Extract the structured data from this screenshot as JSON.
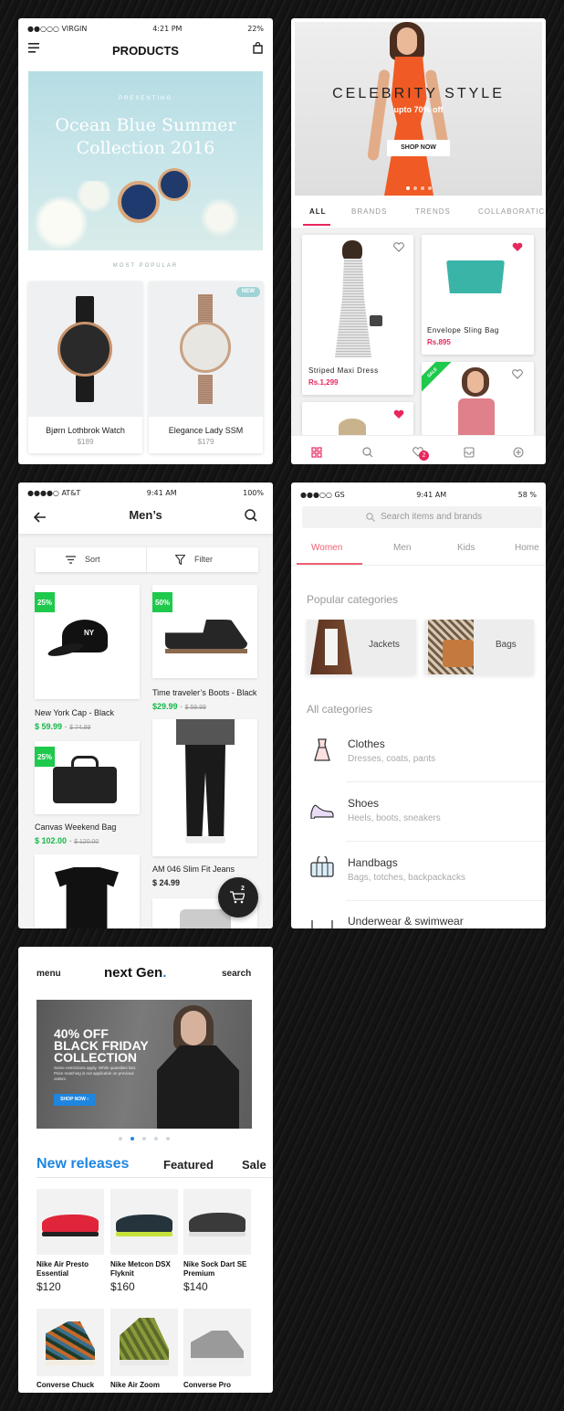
{
  "p1": {
    "status": {
      "carrier": "●●○○○ VIRGIN",
      "time": "4:21 PM",
      "battery": "22%"
    },
    "title": "PRODUCTS",
    "hero": {
      "presenting": "PRESENTING",
      "title1": "Ocean Blue Summer",
      "title2": "Collection 2016"
    },
    "section": "MOST POPULAR",
    "products": [
      {
        "name": "Bjørn Lothbrok Watch",
        "price": "$189"
      },
      {
        "name": "Elegance Lady SSM",
        "price": "$179",
        "badge": "NEW"
      }
    ]
  },
  "p2": {
    "banner": {
      "title": "CELEBRITY STYLE",
      "subtitle": "upto 70% off",
      "cta": "SHOP NOW"
    },
    "tabs": [
      "ALL",
      "BRANDS",
      "TRENDS",
      "COLLABORATIC"
    ],
    "items": [
      {
        "name": "Striped Maxi Dress",
        "price": "Rs.1,299"
      },
      {
        "name": "Envelope Sling Bag",
        "price": "Rs.895"
      }
    ],
    "sale_ribbon": "SALE",
    "cart_count": "2"
  },
  "p3": {
    "status": {
      "carrier": "●●●●○ AT&T",
      "time": "9:41 AM",
      "battery": "100%"
    },
    "title": "Men’s",
    "sort": "Sort",
    "filter": "Filter",
    "items": [
      {
        "badge": "25%",
        "name": "New York Cap - Black",
        "price": "$ 59.99",
        "old": "$ 74.99"
      },
      {
        "badge": "50%",
        "name": "Time traveler’s Boots - Black",
        "price": "$29.99",
        "old": "$ 59.99"
      },
      {
        "badge": "25%",
        "name": "Canvas Weekend Bag",
        "price": "$ 102.00",
        "old": "$ 120.00"
      },
      {
        "name": "AM 046 Slim Fit Jeans",
        "price": "$ 24.99"
      }
    ],
    "cart_count": "2",
    "dash": "-"
  },
  "p4": {
    "status": {
      "carrier": "●●●○○ GS",
      "time": "9:41 AM",
      "battery": "58 %"
    },
    "search_placeholder": "Search items and brands",
    "tabs": [
      "Women",
      "Men",
      "Kids",
      "Home"
    ],
    "popular_heading": "Popular categories",
    "popular": [
      "Jackets",
      "Bags"
    ],
    "all_heading": "All categories",
    "categories": [
      {
        "name": "Clothes",
        "sub": "Dresses, coats, pants"
      },
      {
        "name": "Shoes",
        "sub": "Heels, boots, sneakers"
      },
      {
        "name": "Handbags",
        "sub": "Bags, totches, backpackacks"
      },
      {
        "name": "Underwear & swimwear",
        "sub": ""
      }
    ]
  },
  "p5": {
    "menu": "menu",
    "brand": "next Gen",
    "brand_dot": ".",
    "search": "search",
    "banner": {
      "line1": "40% OFF",
      "line2": "BLACK FRIDAY",
      "line3": "COLLECTION",
      "fine": "Some restrictions apply. While quantities last. Price matching is not applicable on previous orders.",
      "cta": "SHOP NOW"
    },
    "tabs": [
      "New releases",
      "Featured",
      "Sale"
    ],
    "products": [
      {
        "name": "Nike Air Presto Essential",
        "price": "$120"
      },
      {
        "name": "Nike Metcon DSX Flyknit",
        "price": "$160"
      },
      {
        "name": "Nike Sock Dart SE Premium",
        "price": "$140"
      },
      {
        "name": "Converse Chuck",
        "price": ""
      },
      {
        "name": "Nike Air Zoom",
        "price": ""
      },
      {
        "name": "Converse Pro",
        "price": ""
      }
    ]
  },
  "colors": {
    "pink": "#e8275d",
    "green": "#1ec94c",
    "blue": "#1e86e0",
    "teal": "#3bb4a8"
  }
}
